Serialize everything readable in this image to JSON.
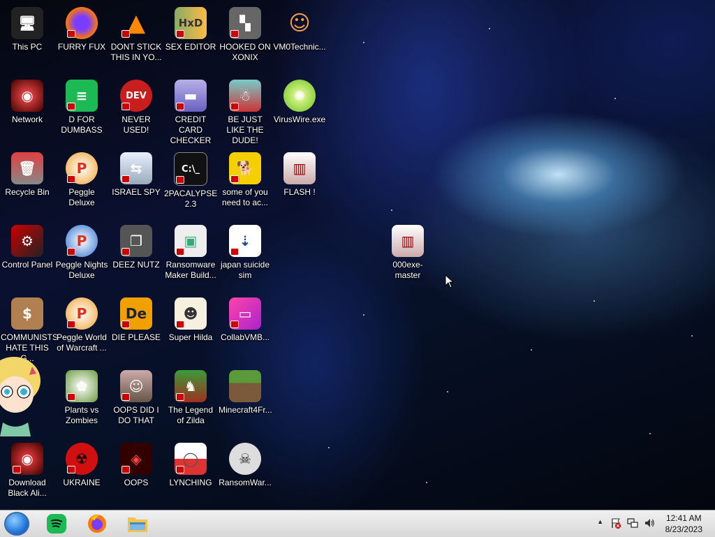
{
  "desktop_icons": [
    {
      "label": "This PC"
    },
    {
      "label": "Network"
    },
    {
      "label": "Recycle Bin"
    },
    {
      "label": "Control Panel"
    },
    {
      "label": "COMMUNISTS HATE THIS G..."
    },
    {
      "label": "Download Black Ali..."
    },
    {
      "label": "FURRY FUX"
    },
    {
      "label": "D FOR DUMBASS"
    },
    {
      "label": "Peggle Deluxe"
    },
    {
      "label": "Peggle Nights Deluxe"
    },
    {
      "label": "Peggle World of Warcraft ..."
    },
    {
      "label": "Plants vs Zombies"
    },
    {
      "label": "UKRAINE"
    },
    {
      "label": "DONT STICK THIS IN YO..."
    },
    {
      "label": "NEVER USED!"
    },
    {
      "label": "ISRAEL SPY"
    },
    {
      "label": "DEEZ NUTZ"
    },
    {
      "label": "DIE PLEASE"
    },
    {
      "label": "OOPS DID I DO THAT"
    },
    {
      "label": "OOPS"
    },
    {
      "label": "SEX EDITOR"
    },
    {
      "label": "CREDIT CARD CHECKER"
    },
    {
      "label": "2PACALYPSE 2.3"
    },
    {
      "label": "Ransomware Maker Build..."
    },
    {
      "label": "Super Hilda"
    },
    {
      "label": "The Legend of Zilda"
    },
    {
      "label": "LYNCHING"
    },
    {
      "label": "HOOKED ON XONIX"
    },
    {
      "label": "BE JUST LIKE THE DUDE!"
    },
    {
      "label": "some of you need to ac..."
    },
    {
      "label": "japan suicide sim"
    },
    {
      "label": "CollabVMB..."
    },
    {
      "label": "Minecraft4Fr..."
    },
    {
      "label": "RansomWar..."
    },
    {
      "label": "VM0Technic..."
    },
    {
      "label": "VirusWire.exe"
    },
    {
      "label": "FLASH !"
    },
    {
      "label": "000exe-master"
    }
  ],
  "icon_art": {
    "dev_text": "DEV",
    "cmd_text": "C:\\_",
    "de_text": "De"
  },
  "taskbar": {
    "pinned": [
      "start-orb",
      "spotify-icon",
      "firefox-icon",
      "file-explorer-icon"
    ],
    "clock_time": "12:41 AM",
    "clock_date": "8/23/2023"
  },
  "colors": {
    "taskbar_bg": "#e2e2e2",
    "label_text": "#ffffff"
  }
}
